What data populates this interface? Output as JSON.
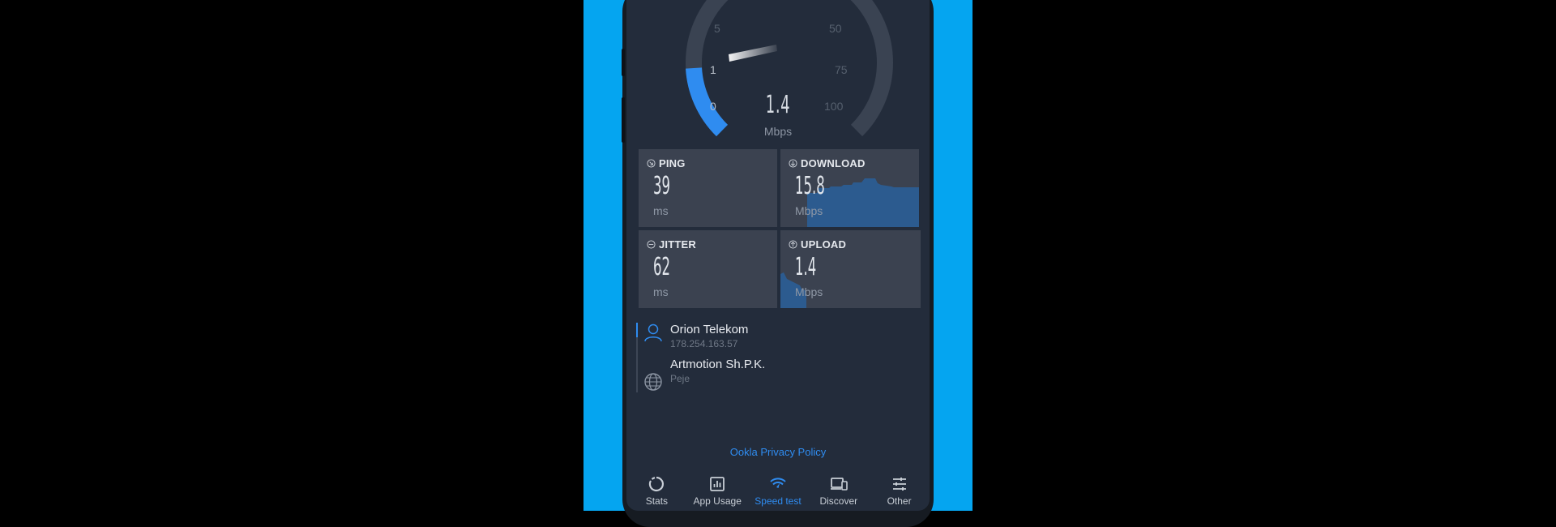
{
  "gauge": {
    "ticks": [
      "0",
      "1",
      "5",
      "50",
      "75",
      "100"
    ],
    "value": "1.4",
    "unit": "Mbps",
    "fraction": 0.19
  },
  "tiles": {
    "ping": {
      "label": "PING",
      "value": "39",
      "unit": "ms",
      "icon": "ping-icon"
    },
    "download": {
      "label": "DOWNLOAD",
      "value": "15.8",
      "unit": "Mbps",
      "icon": "download-icon"
    },
    "jitter": {
      "label": "JITTER",
      "value": "62",
      "unit": "ms",
      "icon": "jitter-icon"
    },
    "upload": {
      "label": "UPLOAD",
      "value": "1.4",
      "unit": "Mbps",
      "icon": "upload-icon"
    }
  },
  "provider": {
    "isp_name": "Orion Telekom",
    "isp_ip": "178.254.163.57",
    "server_name": "Artmotion Sh.P.K.",
    "server_location": "Peje"
  },
  "privacy_link": "Ookla Privacy Policy",
  "tabs": [
    {
      "label": "Stats",
      "icon": "stats-icon"
    },
    {
      "label": "App Usage",
      "icon": "app-usage-icon"
    },
    {
      "label": "Speed test",
      "icon": "speed-test-icon",
      "active": true
    },
    {
      "label": "Discover",
      "icon": "discover-icon"
    },
    {
      "label": "Other",
      "icon": "other-icon"
    }
  ],
  "colors": {
    "accent": "#2f8cf0",
    "background": "#232c3b",
    "tile": "#3b4250",
    "frame": "#05a5f0"
  }
}
